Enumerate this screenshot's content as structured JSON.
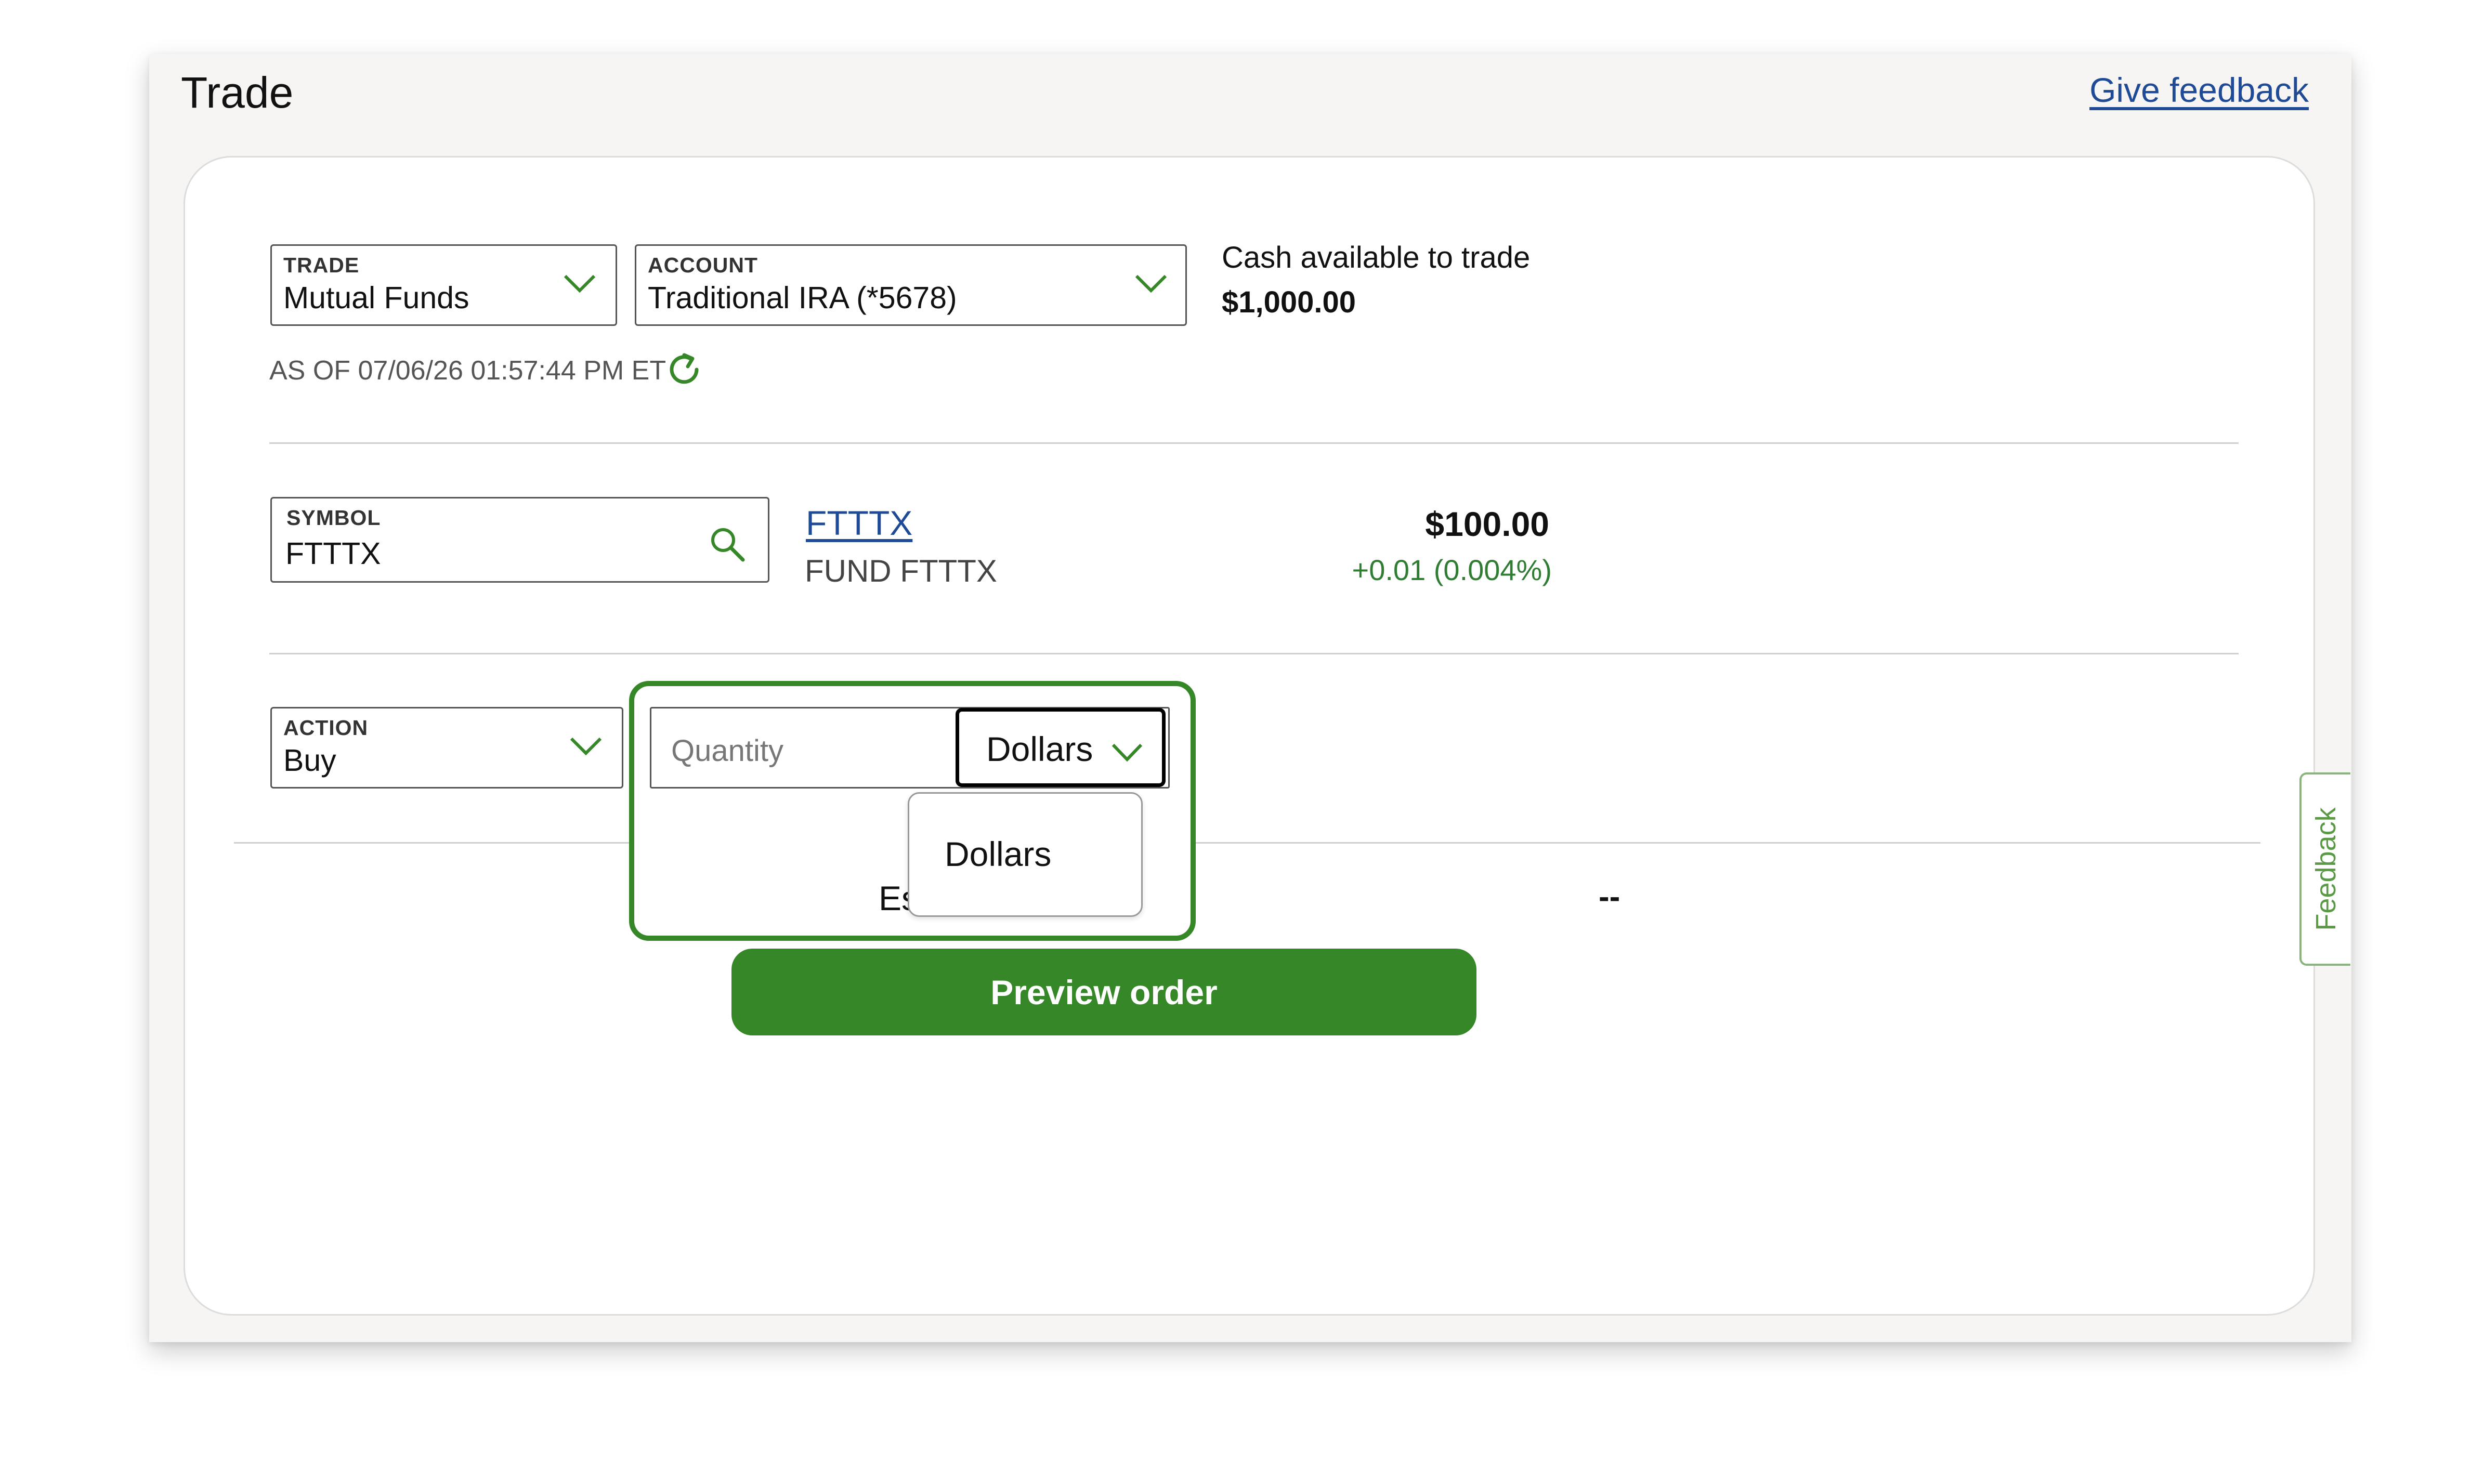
{
  "header": {
    "title": "Trade",
    "feedback_link": "Give feedback"
  },
  "trade_select": {
    "label": "TRADE",
    "value": "Mutual Funds"
  },
  "account_select": {
    "label": "ACCOUNT",
    "value": "Traditional IRA (*5678)"
  },
  "cash": {
    "label": "Cash available to trade",
    "value": "$1,000.00"
  },
  "timestamp": {
    "text": "AS OF 07/06/26 01:57:44 PM ET"
  },
  "symbol": {
    "label": "SYMBOL",
    "value": "FTTTX"
  },
  "quote": {
    "ticker": "FTTTX",
    "name": "FUND FTTTX",
    "price": "$100.00",
    "change": "+0.01 (0.004%)"
  },
  "action_select": {
    "label": "ACTION",
    "value": "Buy"
  },
  "quantity": {
    "placeholder": "Quantity"
  },
  "units": {
    "selected": "Dollars",
    "options": [
      "Dollars"
    ]
  },
  "estimate": {
    "label_visible": "Es",
    "value": "--"
  },
  "preview_button": "Preview order",
  "side_tab": "Feedback",
  "colors": {
    "accent_green": "#368727",
    "link_blue": "#1f4a96",
    "positive_green": "#2e7d32"
  }
}
